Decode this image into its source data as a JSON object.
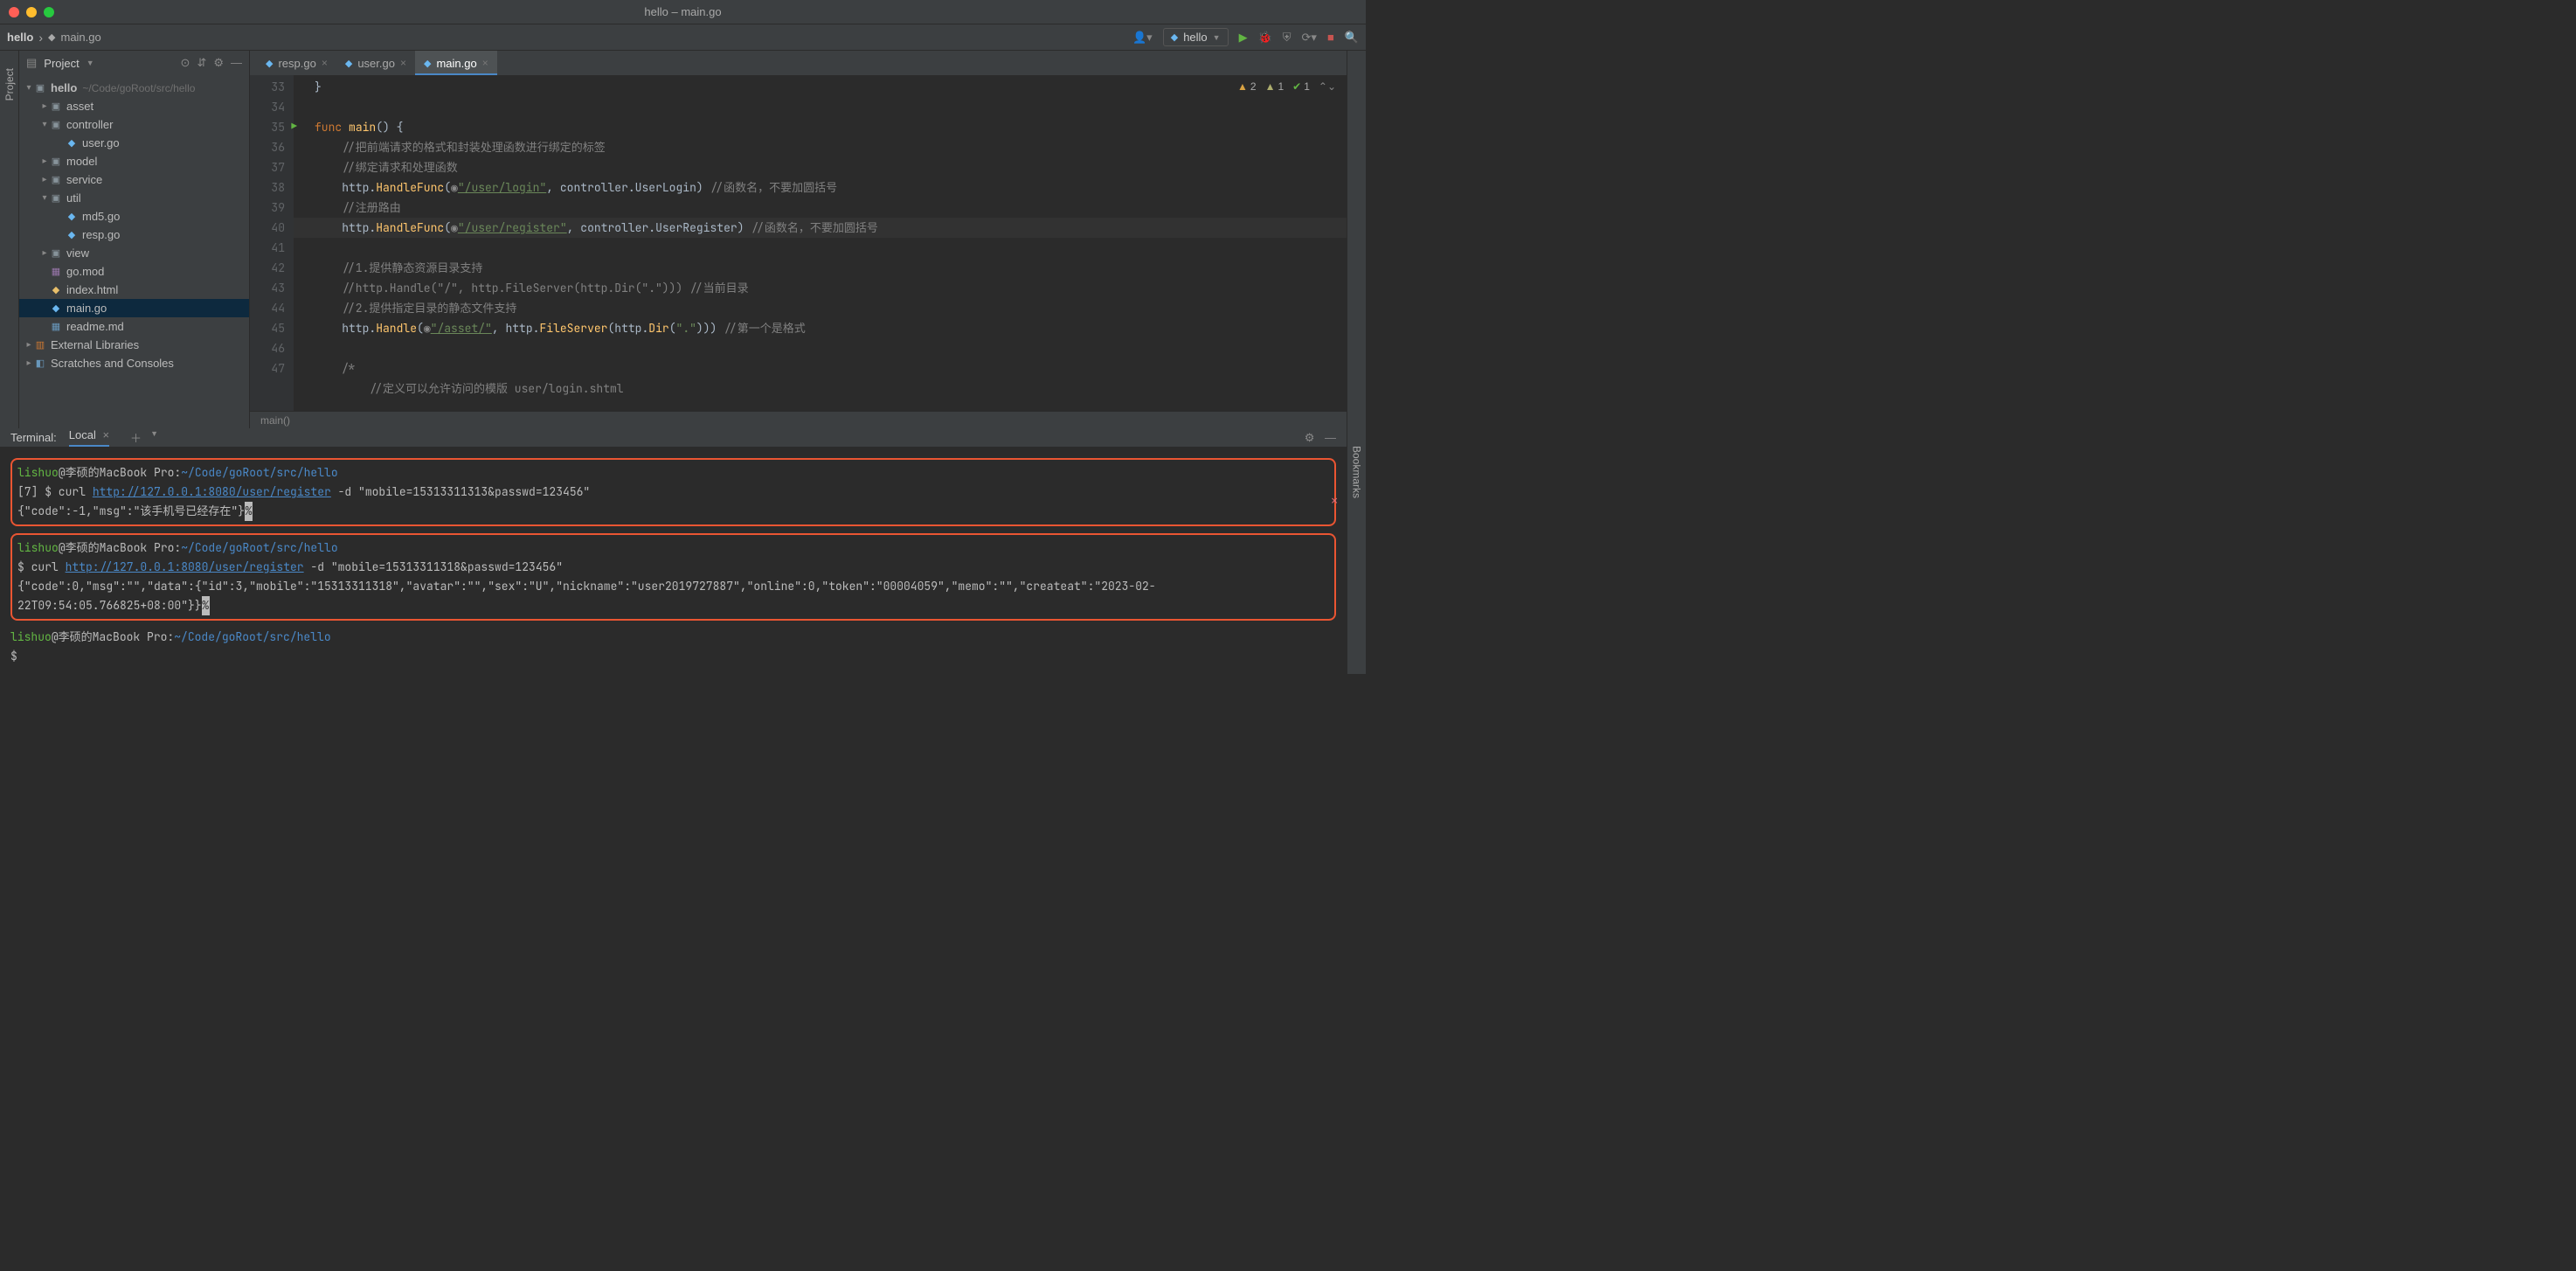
{
  "window_title": "hello – main.go",
  "breadcrumb": {
    "root": "hello",
    "file": "main.go"
  },
  "nav": {
    "run_config": "hello",
    "search_tooltip": "Search"
  },
  "project_panel": {
    "title": "Project",
    "tree": {
      "root_name": "hello",
      "root_path": "~/Code/goRoot/src/hello",
      "asset": "asset",
      "controller": "controller",
      "user_go": "user.go",
      "model": "model",
      "service": "service",
      "util": "util",
      "md5_go": "md5.go",
      "resp_go": "resp.go",
      "view": "view",
      "go_mod": "go.mod",
      "index_html": "index.html",
      "main_go": "main.go",
      "readme": "readme.md",
      "external": "External Libraries",
      "scratches": "Scratches and Consoles"
    }
  },
  "sidebar_left_tab": "Project",
  "sidebar_right_tab": "Bookmarks",
  "tabs": {
    "t1": "resp.go",
    "t2": "user.go",
    "t3": "main.go"
  },
  "inspections": {
    "warn_count": "2",
    "weak_count": "1",
    "ok_count": "1"
  },
  "gutter_start": 33,
  "gutter_end": 47,
  "code": {
    "l33": "}",
    "l35_func": "func",
    "l35_main": "main",
    "l35_rest": "() {",
    "l36": "    //把前端请求的格式和封装处理函数进行绑定的标签",
    "l37": "    //绑定请求和处理函数",
    "l38_a": "    http.",
    "l38_fn": "HandleFunc",
    "l38_b": "(",
    "l38_str": "\"/user/login\"",
    "l38_c": ", controller.",
    "l38_id": "UserLogin",
    "l38_d": ") ",
    "l38_cmt": "//函数名，不要加圆括号",
    "l39": "    //注册路由",
    "l40_a": "    http.",
    "l40_fn": "HandleFunc",
    "l40_str": "\"/user/register\"",
    "l40_c": ", controller.",
    "l40_id": "UserRegister",
    "l40_d": ") ",
    "l40_cmt": "//函数名，不要加圆括号",
    "l41": "    //1.提供静态资源目录支持",
    "l42_a": "    //http.Handle(\"/\", http.FileServer(http.Dir(\".\"))) //当前目录",
    "l43": "    //2.提供指定目录的静态文件支持",
    "l44_a": "    http.",
    "l44_fn": "Handle",
    "l44_str1": "\"/asset/\"",
    "l44_mid": ", http.",
    "l44_fn2": "FileServer",
    "l44_b": "(http.",
    "l44_fn3": "Dir",
    "l44_str2": "\".\"",
    "l44_c": "))) ",
    "l44_cmt": "//第一个是格式",
    "l46": "    /*",
    "l47": "        //定义可以允许访问的模版 user/login.shtml"
  },
  "editor_crumb": "main()",
  "terminal": {
    "title": "Terminal:",
    "tab": "Local",
    "prompt_user": "lishuo",
    "prompt_at": "@李硕的MacBook Pro",
    "prompt_path": "~/Code/goRoot/src/hello",
    "b1_line2_pre": "[7] $ curl ",
    "b1_url": "http://127.0.0.1:8080/user/register",
    "b1_line2_post": " -d \"mobile=15313311313&passwd=123456\"",
    "b1_line3": "{\"code\":-1,\"msg\":\"该手机号已经存在\"}",
    "b2_line2_pre": "$ curl ",
    "b2_url": "http://127.0.0.1:8080/user/register",
    "b2_line2_post": " -d \"mobile=15313311318&passwd=123456\"",
    "b2_line3": "{\"code\":0,\"msg\":\"\",\"data\":{\"id\":3,\"mobile\":\"15313311318\",\"avatar\":\"\",\"sex\":\"U\",\"nickname\":\"user2019727887\",\"online\":0,\"token\":\"00004059\",\"memo\":\"\",\"createat\":\"2023-02-22T09:54:05.766825+08:00\"}}",
    "final_prompt": "$"
  }
}
